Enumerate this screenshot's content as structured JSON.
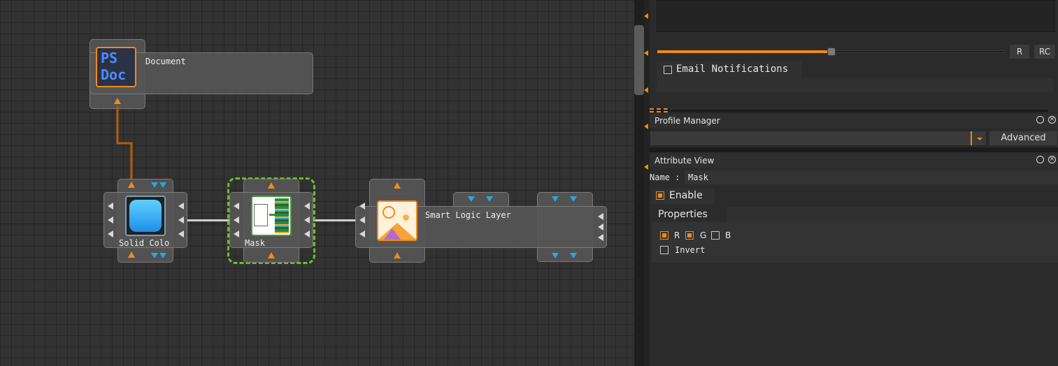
{
  "graph": {
    "nodes": {
      "document": {
        "label": "Document",
        "icon_text_line1": "PS",
        "icon_text_line2": "Doc"
      },
      "solid_color": {
        "label": "Solid Colo"
      },
      "mask": {
        "label": "Mask"
      },
      "smart_logic": {
        "label": "Smart Logic Layer"
      }
    }
  },
  "panel": {
    "top": {
      "slider_fraction": 0.5,
      "r_button": "R",
      "rc_button": "RC",
      "email_label": "Email Notifications"
    },
    "profile_manager": {
      "title": "Profile Manager",
      "dropdown_value": "",
      "advanced_button": "Advanced"
    },
    "attribute_view": {
      "title": "Attribute View",
      "name_label": "Name :",
      "name_value": "Mask",
      "enable_label": "Enable",
      "properties_label": "Properties",
      "r_label": "R",
      "g_label": "G",
      "b_label": "B",
      "invert_label": "Invert"
    }
  },
  "colors": {
    "accent": "#f08a1c",
    "port_blue": "#2aa6e0",
    "mask_outline": "#6fbf2a"
  }
}
